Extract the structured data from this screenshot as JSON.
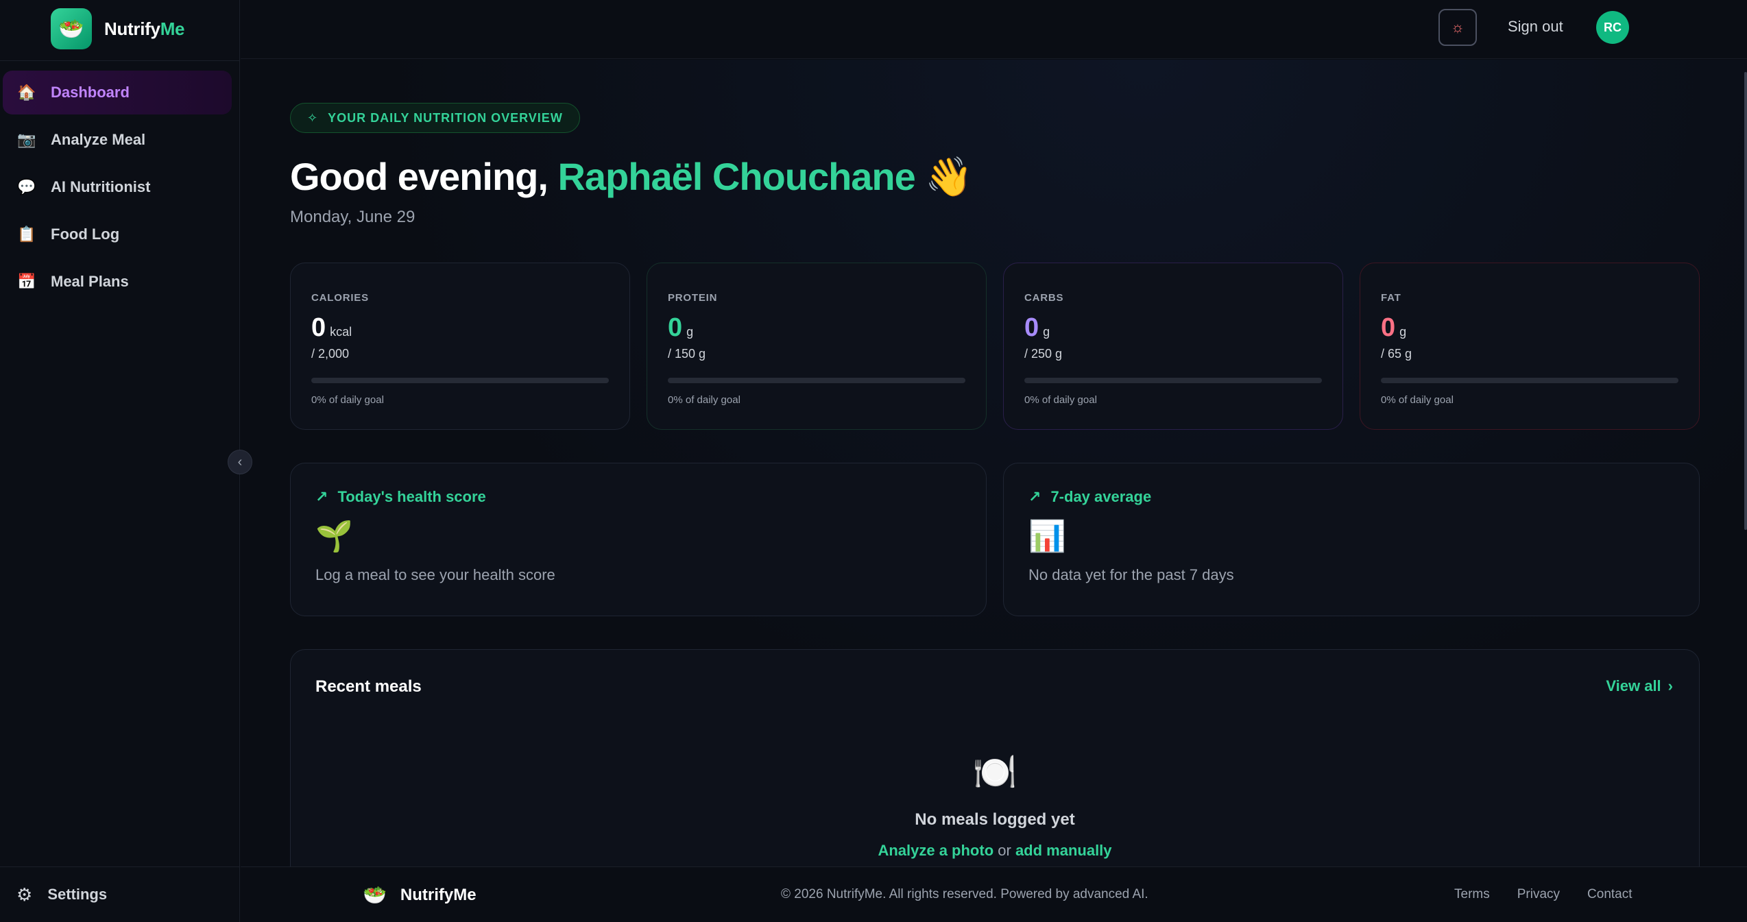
{
  "brand": {
    "name_part1": "Nutrify",
    "name_part2": "Me",
    "logo_emoji": "🥗"
  },
  "sidebar": {
    "items": [
      {
        "label": "Dashboard",
        "icon": "🏠",
        "icon_name": "house-icon",
        "active": true
      },
      {
        "label": "Analyze Meal",
        "icon": "📷",
        "icon_name": "camera-icon",
        "active": false
      },
      {
        "label": "AI Nutritionist",
        "icon": "💬",
        "icon_name": "speech-bubble-icon",
        "active": false
      },
      {
        "label": "Food Log",
        "icon": "📋",
        "icon_name": "clipboard-icon",
        "active": false
      },
      {
        "label": "Meal Plans",
        "icon": "📅",
        "icon_name": "calendar-icon",
        "active": false
      }
    ],
    "collapse_icon": "‹",
    "settings_label": "Settings",
    "settings_icon": "⚙"
  },
  "header": {
    "theme_icon": "☼",
    "signout_label": "Sign out",
    "avatar_initials": "RC"
  },
  "main": {
    "badge_icon": "✧",
    "badge_text": "YOUR DAILY NUTRITION OVERVIEW",
    "greeting_prefix": "Good evening, ",
    "user_name": "Raphaël Chouchane",
    "wave_emoji": "👋",
    "date": "Monday, June 29",
    "stats": [
      {
        "label": "CALORIES",
        "value": "0",
        "unit": "kcal",
        "goal": "/ 2,000",
        "pct_text": "0% of daily goal",
        "progress": 0,
        "color": "#ffffff",
        "border": "#1f2533"
      },
      {
        "label": "PROTEIN",
        "value": "0",
        "unit": "g",
        "goal": "/ 150 g",
        "pct_text": "0% of daily goal",
        "progress": 0,
        "color": "#34d399",
        "border": "#15302a"
      },
      {
        "label": "CARBS",
        "value": "0",
        "unit": "g",
        "goal": "/ 250 g",
        "pct_text": "0% of daily goal",
        "progress": 0,
        "color": "#a78bfa",
        "border": "#2a1f4a"
      },
      {
        "label": "FAT",
        "value": "0",
        "unit": "g",
        "goal": "/ 65 g",
        "pct_text": "0% of daily goal",
        "progress": 0,
        "color": "#fb7185",
        "border": "#3d1622"
      }
    ],
    "health_score": {
      "title": "Today's health score",
      "emoji": "🌱",
      "text": "Log a meal to see your health score"
    },
    "weekly": {
      "title": "7-day average",
      "emoji": "📊",
      "text": "No data yet for the past 7 days"
    },
    "trend_icon": "↗",
    "recent": {
      "title": "Recent meals",
      "view_all": "View all",
      "view_all_icon": "›",
      "empty_icon": "🍽️",
      "empty_title": "No meals logged yet",
      "link_analyze": "Analyze a photo",
      "or_text": " or ",
      "link_manual": "add manually"
    }
  },
  "footer": {
    "logo_emoji": "🥗",
    "name": "NutrifyMe",
    "copyright": "© 2026 NutrifyMe. All rights reserved. Powered by advanced AI.",
    "links": [
      "Terms",
      "Privacy",
      "Contact"
    ]
  },
  "colors": {
    "accent": "#34d399",
    "active_nav": "#c084fc",
    "background": "#0a0d14"
  }
}
